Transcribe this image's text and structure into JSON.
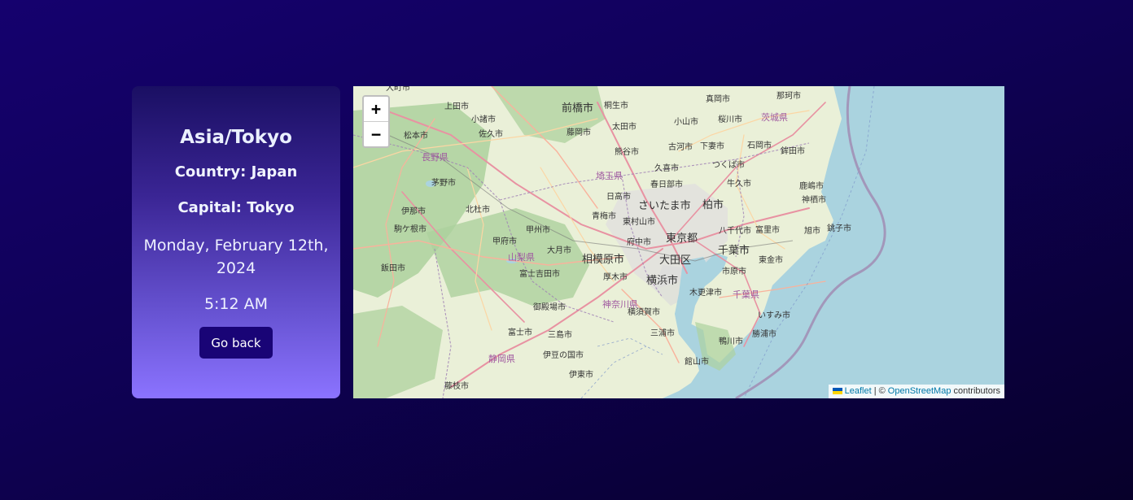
{
  "card": {
    "timezone": "Asia/Tokyo",
    "country": "Country: Japan",
    "capital": "Capital: Tokyo",
    "date": "Monday, February 12th, 2024",
    "time": "5:12 AM",
    "button_label": "Go back"
  },
  "map": {
    "zoom_in": "+",
    "zoom_out": "−",
    "attribution": {
      "leaflet": "Leaflet",
      "separator": "| ©",
      "osm": "OpenStreetMap",
      "contributors": "contributors"
    },
    "labels": {
      "maebashi": "前橋市",
      "kiryu": "桐生市",
      "ueda": "上田市",
      "komoro": "小諸市",
      "saku": "佐久市",
      "fujioka": "藤岡市",
      "ota": "太田市",
      "oyama": "小山市",
      "mooka": "真岡市",
      "sakuragawa": "桜川市",
      "naka": "那珂市",
      "ibaraki": "茨城県",
      "matsumoto": "松本市",
      "nagano": "長野県",
      "kumagaya": "熊谷市",
      "koga": "古河市",
      "shimotsuma": "下妻市",
      "ishioka": "石岡市",
      "hokota": "鉾田市",
      "kuki": "久喜市",
      "tsukuba": "つくば市",
      "saitama_pref": "埼玉県",
      "chino": "茅野市",
      "kasukabe": "春日部市",
      "ushiku": "牛久市",
      "kashima": "鹿嶋市",
      "kamisu": "神栖市",
      "hidaka": "日高市",
      "saitama": "さいたま市",
      "kashiwa": "柏市",
      "ina": "伊那市",
      "hokuto": "北杜市",
      "ome": "青梅市",
      "higashimurayama": "東村山市",
      "yachiyo": "八千代市",
      "tomisato": "富里市",
      "asahi": "旭市",
      "choshi": "銚子市",
      "komagane": "駒ケ根市",
      "kofu": "甲府市",
      "koshu": "甲州市",
      "fuchu": "府中市",
      "tokyo": "東京都",
      "chiba": "千葉市",
      "otsuki": "大月市",
      "yamanashi": "山梨県",
      "sagamihara": "相模原市",
      "ota_ku": "大田区",
      "togane": "東金市",
      "iida": "飯田市",
      "fujiyoshida": "富士吉田市",
      "atsugi": "厚木市",
      "ichihara": "市原市",
      "yokohama": "横浜市",
      "kisarazu": "木更津市",
      "chiba_pref": "千葉県",
      "gotemba": "御殿場市",
      "kanagawa": "神奈川県",
      "yokosuka": "横須賀市",
      "isumi": "いすみ市",
      "fuji": "富士市",
      "mishima": "三島市",
      "miura": "三浦市",
      "katsuura": "勝浦市",
      "kamogawa": "鴨川市",
      "shizuoka_pref": "静岡県",
      "izunokuni": "伊豆の国市",
      "tateyama": "館山市",
      "ito": "伊東市",
      "fujieda": "藤枝市",
      "ohmachi": "大町市"
    }
  }
}
